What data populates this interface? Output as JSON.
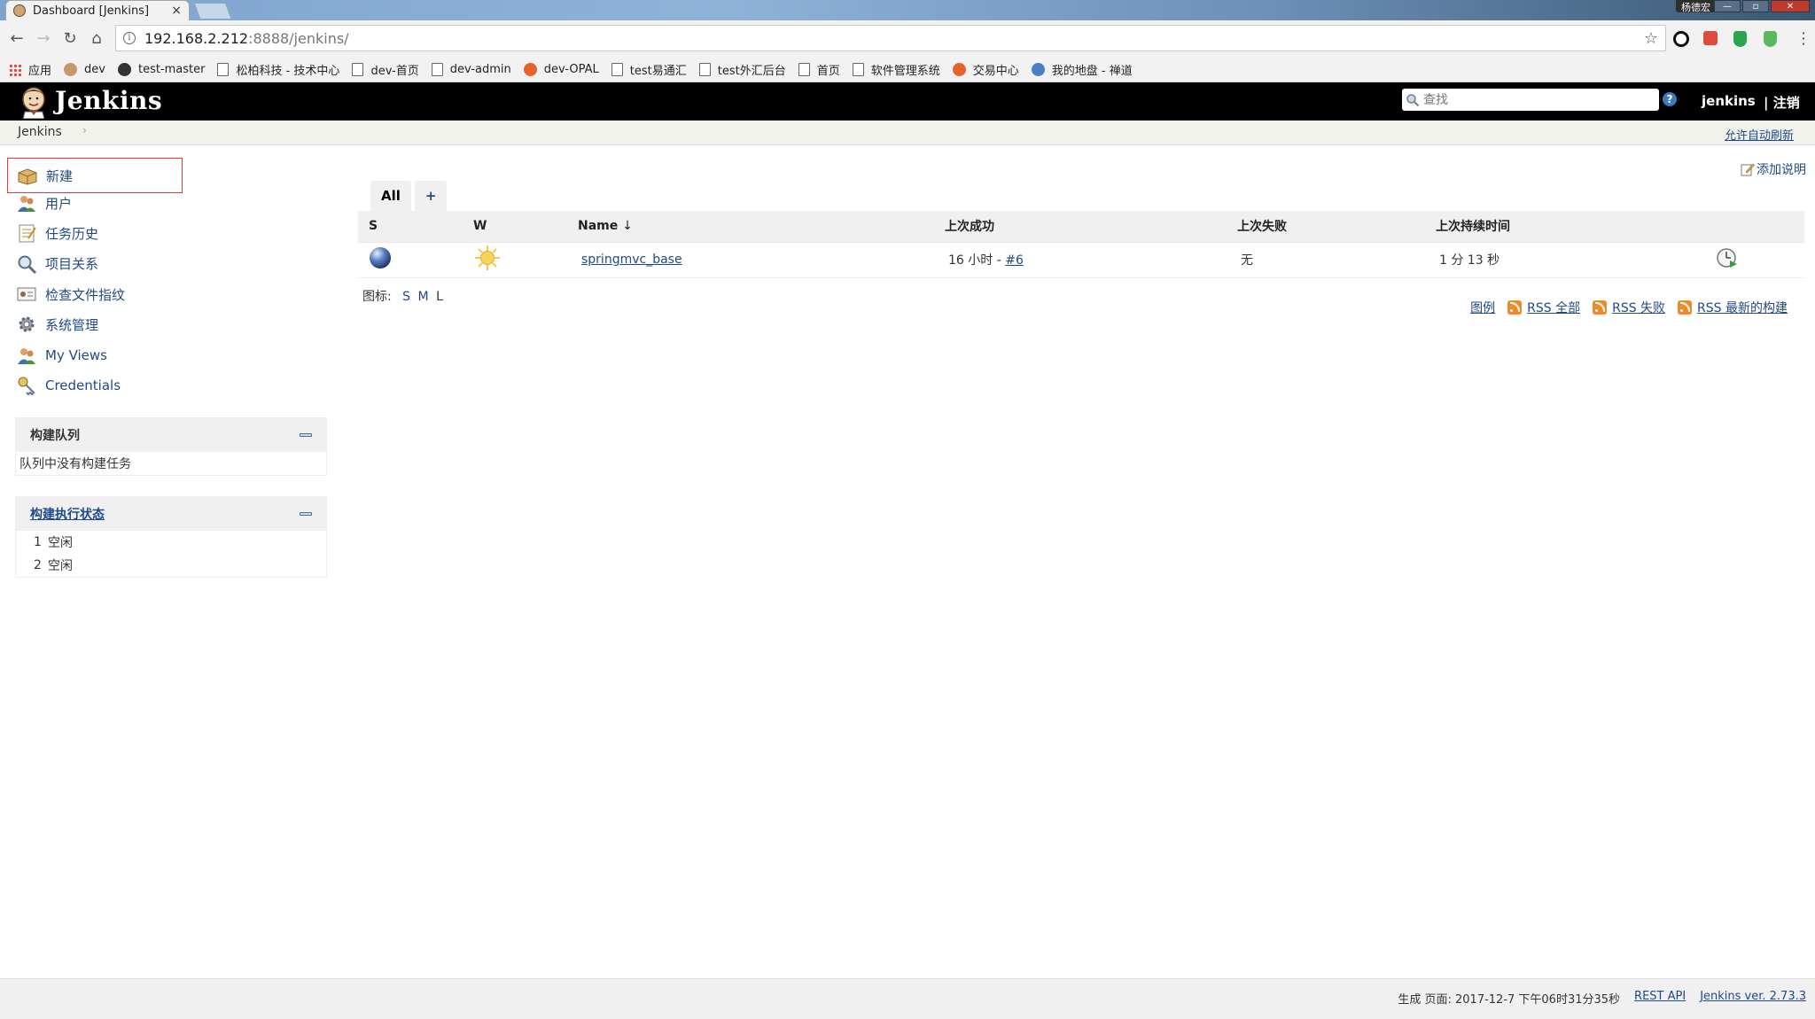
{
  "browser": {
    "tab_title": "Dashboard [Jenkins]",
    "tab_close": "×",
    "profile_name": "杨德宏",
    "url_host": "192.168.2.212",
    "url_rest": ":8888/jenkins/",
    "bookmarks": [
      "应用",
      "dev",
      "test-master",
      "松柏科技 - 技术中心",
      "dev-首页",
      "dev-admin",
      "dev-OPAL",
      "test易通汇",
      "test外汇后台",
      "首页",
      "软件管理系统",
      "交易中心",
      "我的地盘 - 禅道"
    ]
  },
  "header": {
    "title": "Jenkins",
    "search_placeholder": "查找",
    "help": "?",
    "user": "jenkins",
    "logout": "| 注销"
  },
  "breadcrumb": {
    "home": "Jenkins",
    "sep": "›",
    "auto_refresh": "允许自动刷新"
  },
  "sidebar": {
    "tasks": [
      "新建",
      "用户",
      "任务历史",
      "项目关系",
      "检查文件指纹",
      "系统管理",
      "My Views",
      "Credentials"
    ],
    "queue": {
      "title": "构建队列",
      "empty": "队列中没有构建任务"
    },
    "executors": {
      "title": "构建执行状态",
      "rows": [
        {
          "num": "1",
          "state": "空闲"
        },
        {
          "num": "2",
          "state": "空闲"
        }
      ]
    }
  },
  "main": {
    "add_description": "添加说明",
    "view_tabs": [
      "All",
      "+"
    ],
    "columns": {
      "s": "S",
      "w": "W",
      "name": "Name",
      "sort": "↓",
      "last_success": "上次成功",
      "last_failure": "上次失败",
      "last_duration": "上次持续时间"
    },
    "job": {
      "name": "springmvc_base",
      "last_success_prefix": "16 小时 - ",
      "last_success_build": "#6",
      "last_failure": "无",
      "last_duration": "1 分 13 秒"
    },
    "icon_label": "图标:",
    "icon_sizes": [
      "S",
      "M",
      "L"
    ],
    "legend": "图例",
    "rss": [
      "RSS 全部",
      "RSS 失败",
      "RSS 最新的构建"
    ]
  },
  "footer": {
    "generated": "生成 页面: 2017-12-7 下午06时31分35秒",
    "rest_api": "REST API",
    "version": "Jenkins ver. 2.73.3"
  },
  "colors": {
    "header_bg": "#000000",
    "link": "#204a87",
    "highlight_border": "#e53935"
  }
}
